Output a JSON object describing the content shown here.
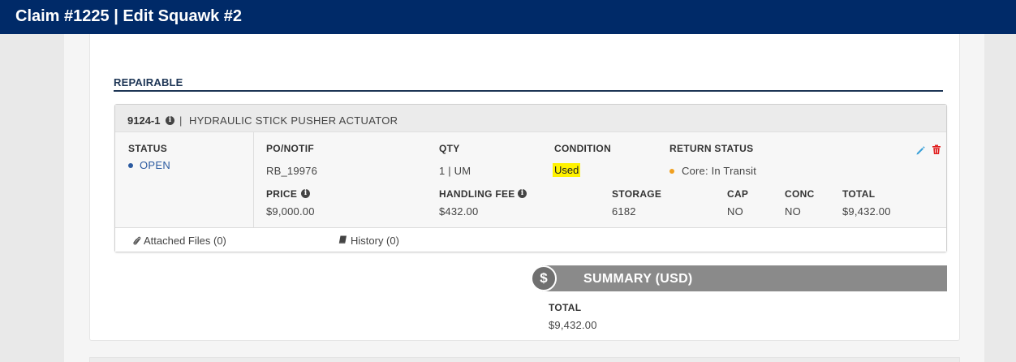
{
  "header": {
    "title": "Claim #1225 | Edit Squawk #2"
  },
  "section": {
    "title": "REPAIRABLE"
  },
  "item": {
    "part_number": "9124-1",
    "separator": "|",
    "description": "HYDRAULIC STICK PUSHER ACTUATOR",
    "status": {
      "label": "STATUS",
      "value": "OPEN",
      "color": "#2b5aa0"
    },
    "po_notif": {
      "label": "PO/NOTIF",
      "value": "RB_19976"
    },
    "qty": {
      "label": "QTY",
      "value": "1 | UM"
    },
    "condition": {
      "label": "CONDITION",
      "value": "Used",
      "highlight": "#fff200"
    },
    "return_status": {
      "label": "RETURN STATUS",
      "value": "Core: In Transit",
      "color": "#f0a020"
    },
    "price": {
      "label": "PRICE",
      "value": "$9,000.00"
    },
    "handling_fee": {
      "label": "HANDLING FEE",
      "value": "$432.00"
    },
    "storage": {
      "label": "STORAGE",
      "value": "6182"
    },
    "cap": {
      "label": "CAP",
      "value": "NO"
    },
    "conc": {
      "label": "CONC",
      "value": "NO"
    },
    "total": {
      "label": "TOTAL",
      "value": "$9,432.00"
    },
    "actions": {
      "edit_icon": "pencil-icon",
      "delete_icon": "trash-icon",
      "edit_color": "#3aa0d8",
      "delete_color": "#e02020"
    },
    "footer": {
      "attached_files": "Attached Files (0)",
      "history": "History (0)"
    }
  },
  "summary": {
    "title": "SUMMARY (USD)",
    "currency_symbol": "$",
    "total_label": "TOTAL",
    "total_value": "$9,432.00"
  },
  "colors": {
    "header_bg": "#002a68",
    "section_rule": "#1d3555",
    "summary_bar": "#8a8a8a"
  }
}
